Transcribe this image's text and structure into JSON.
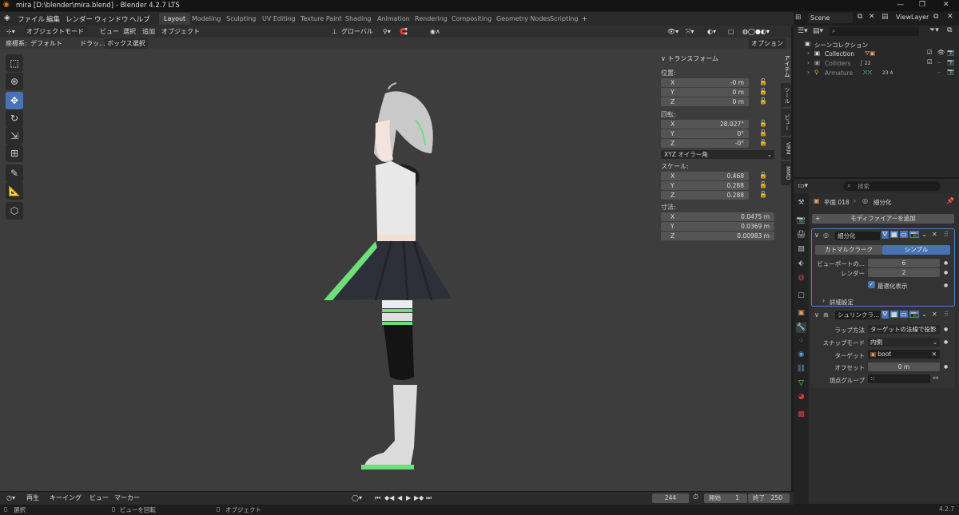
{
  "titlebar": {
    "title": "mira [D:\\blender\\mira.blend] - Blender 4.2.7 LTS",
    "minimize": "—",
    "maximize": "❐",
    "close": "✕"
  },
  "menu": [
    "ファイル",
    "編集",
    "レンダー",
    "ウィンドウ",
    "ヘルプ"
  ],
  "workspaces": [
    "Layout",
    "Modeling",
    "Sculpting",
    "UV Editing",
    "Texture Paint",
    "Shading",
    "Animation",
    "Rendering",
    "Compositing",
    "Geometry Nodes",
    "Scripting"
  ],
  "workspace_add": "+",
  "scene": {
    "name": "Scene",
    "view_layer": "ViewLayer"
  },
  "viewport_header": {
    "mode": "オブジェクトモード",
    "view": "ビュー",
    "select": "選択",
    "add": "追加",
    "object": "オブジェクト",
    "transform_orientation": "グローバル",
    "options": "オプション"
  },
  "viewport_header2": {
    "coord_label": "座標系:",
    "coord_value": "デフォルト",
    "drag_label": "ドラッ...",
    "select_mode": "ボックス選択"
  },
  "npanel": {
    "section": "トランスフォーム",
    "location_label": "位置:",
    "location": [
      {
        "axis": "X",
        "value": "-0 m"
      },
      {
        "axis": "Y",
        "value": "0 m"
      },
      {
        "axis": "Z",
        "value": "0 m"
      }
    ],
    "rotation_label": "回転:",
    "rotation": [
      {
        "axis": "X",
        "value": "28.027°"
      },
      {
        "axis": "Y",
        "value": "0°"
      },
      {
        "axis": "Z",
        "value": "-0°"
      }
    ],
    "rotation_mode": "XYZ オイラー角",
    "scale_label": "スケール:",
    "scale": [
      {
        "axis": "X",
        "value": "0.468"
      },
      {
        "axis": "Y",
        "value": "0.288"
      },
      {
        "axis": "Z",
        "value": "0.288"
      }
    ],
    "dimensions_label": "寸法:",
    "dimensions": [
      {
        "axis": "X",
        "value": "0.0475 m"
      },
      {
        "axis": "Y",
        "value": "0.0369 m"
      },
      {
        "axis": "Z",
        "value": "0.00983 m"
      }
    ]
  },
  "vtabs": [
    "アイテム",
    "ツール",
    "ビュー",
    "VRM",
    "MMD"
  ],
  "outliner": {
    "search_placeholder": "",
    "root": "シーンコレクション",
    "items": [
      {
        "label": "Collection",
        "badge": ""
      },
      {
        "label": "Colliders",
        "badge": "22"
      },
      {
        "label": "Armature",
        "badge": "23 4"
      }
    ]
  },
  "properties": {
    "search_placeholder": "検索",
    "breadcrumb_object": "平面.018",
    "breadcrumb_modifier": "細分化",
    "add_modifier": "モディファイアーを追加",
    "subdiv": {
      "name": "細分化",
      "tab_catmull": "カトマルクラーク",
      "tab_simple": "シンプル",
      "viewport_label": "ビューポートの...",
      "viewport_value": "6",
      "render_label": "レンダー",
      "render_value": "2",
      "optimal_label": "最適化表示",
      "advanced": "詳細設定"
    },
    "shrinkwrap": {
      "name": "シュリンクラ...",
      "wrap_method_label": "ラップ方法",
      "wrap_method": "ターゲットの法線で投影",
      "snap_mode_label": "スナップモード",
      "snap_mode": "内側",
      "target_label": "ターゲット",
      "target": "boot",
      "offset_label": "オフセット",
      "offset": "0 m",
      "vgroup_label": "頂点グループ"
    }
  },
  "timeline": {
    "playback": "再生",
    "keying": "キーイング",
    "view": "ビュー",
    "marker": "マーカー",
    "current_frame": "244",
    "start_label": "開始",
    "start": "1",
    "end_label": "終了",
    "end": "250"
  },
  "statusbar": {
    "select": "選択",
    "rotate": "ビューを回転",
    "object": "オブジェクト",
    "version": "4.2.7"
  },
  "colors": {
    "accent": "#4772b3",
    "viewport": "#3d3d3d"
  }
}
